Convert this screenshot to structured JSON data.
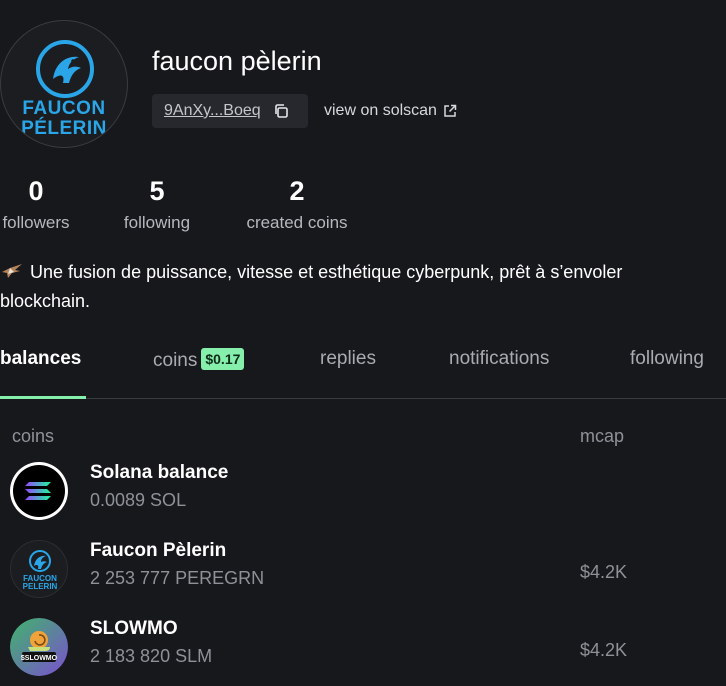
{
  "profile": {
    "name": "faucon pèlerin",
    "avatar_text_1": "FAUCON",
    "avatar_text_2": "PÉLERIN",
    "address": "9AnXy...Boeq",
    "solscan_label": "view on solscan",
    "bio_line_1": "Une fusion de puissance, vitesse et esthétique cyberpunk, prêt à s’envoler",
    "bio_line_2": "blockchain."
  },
  "stats": [
    {
      "value": "0",
      "label": "followers"
    },
    {
      "value": "5",
      "label": "following"
    },
    {
      "value": "2",
      "label": "created coins"
    }
  ],
  "tabs": {
    "balances": "balances",
    "coins": "coins",
    "coins_badge": "$0.17",
    "replies": "replies",
    "notifications": "notifications",
    "following": "following",
    "active": "balances"
  },
  "table": {
    "col_coins": "coins",
    "col_mcap": "mcap",
    "rows": [
      {
        "name": "Solana balance",
        "amount": "0.0089 SOL",
        "mcap": "",
        "icon": "solana-icon"
      },
      {
        "name": "Faucon Pèlerin",
        "amount": "2 253 777 PEREGRN",
        "mcap": "$4.2K",
        "icon": "faucon-logo-icon",
        "logo_text_1": "FAUCON",
        "logo_text_2": "PELERIN"
      },
      {
        "name": "SLOWMO",
        "amount": "2 183 820 SLM",
        "mcap": "$4.2K",
        "icon": "snail-icon",
        "logo_text": "$SLOWMO"
      }
    ]
  },
  "colors": {
    "background": "#17181c",
    "accent_green": "#86efac",
    "brand_blue": "#2aa6e8"
  }
}
